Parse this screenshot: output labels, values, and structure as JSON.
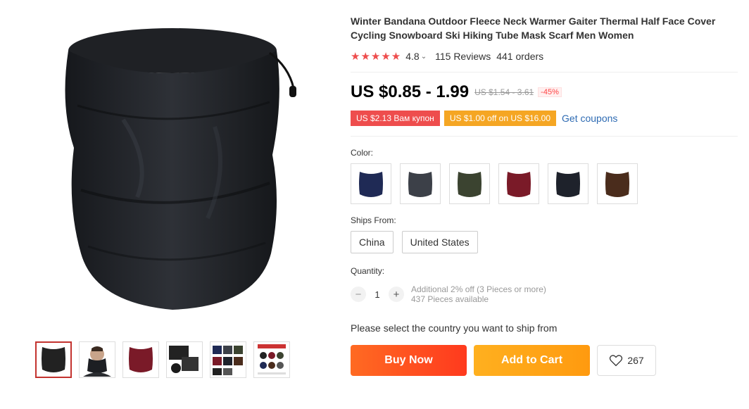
{
  "product": {
    "title": "Winter Bandana Outdoor Fleece Neck Warmer Gaiter Thermal Half Face Cover Cycling Snowboard Ski Hiking Tube Mask Scarf Men Women",
    "stars": "★★★★★",
    "rating": "4.8",
    "reviews": "115 Reviews",
    "orders": "441 orders"
  },
  "gallery": {
    "thumbnails": [
      "black-neck-warmer",
      "man-wearing-mask",
      "red-neck-warmer",
      "neck-warmer-detail",
      "color-grid",
      "size-chart"
    ],
    "active_index": 0
  },
  "price": {
    "current": "US $0.85 - 1.99",
    "original": "US $1.54 - 3.61",
    "discount": "-45%"
  },
  "coupons": {
    "coupon1": "US $2.13 Вам купон",
    "coupon2": "US $1.00 off on US $16.00",
    "get_coupons": "Get coupons"
  },
  "color": {
    "label": "Color:",
    "swatches": [
      {
        "name": "navy",
        "hex": "#1f2a55"
      },
      {
        "name": "gray",
        "hex": "#3c4048"
      },
      {
        "name": "army-green",
        "hex": "#3b4330"
      },
      {
        "name": "wine-red",
        "hex": "#7a1a28"
      },
      {
        "name": "black",
        "hex": "#1e222b"
      },
      {
        "name": "brown",
        "hex": "#4a2c1c"
      }
    ]
  },
  "ships_from": {
    "label": "Ships From:",
    "options": [
      "China",
      "United States"
    ]
  },
  "quantity": {
    "label": "Quantity:",
    "value": "1",
    "minus": "−",
    "plus": "+",
    "offer": "Additional 2% off (3 Pieces or more)",
    "available": "437 Pieces available"
  },
  "shipping_message": "Please select the country you want to ship from",
  "actions": {
    "buy_now": "Buy Now",
    "add_to_cart": "Add to Cart",
    "wishlist_count": "267"
  },
  "colors": {
    "accent_red": "#ee4d4d",
    "buy": "#ff4b1f",
    "cart": "#ffa31a"
  }
}
